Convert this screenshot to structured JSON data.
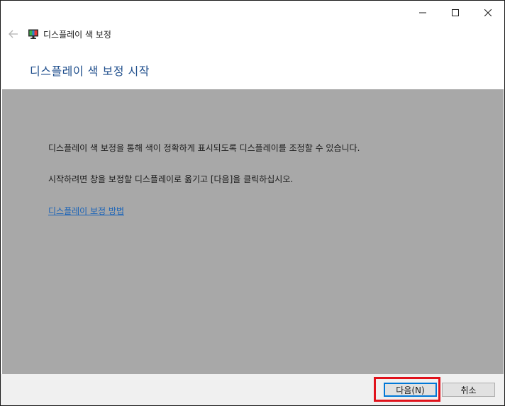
{
  "window": {
    "title": "디스플레이 색 보정",
    "caption_buttons": {
      "minimize_icon": "minimize-icon",
      "maximize_icon": "maximize-icon",
      "close_icon": "close-icon"
    }
  },
  "nav": {
    "back_icon": "back-arrow-icon",
    "app_icon": "display-icon",
    "app_title": "디스플레이 색 보정"
  },
  "page": {
    "heading": "디스플레이 색 보정 시작",
    "line1": "디스플레이 색 보정을 통해 색이 정확하게 표시되도록 디스플레이를 조정할 수 있습니다.",
    "line2": "시작하려면 창을 보정할 디스플레이로 옮기고 [다음]을 클릭하십시오.",
    "help_link": "디스플레이 보정 방법"
  },
  "footer": {
    "next_label": "다음(N)",
    "cancel_label": "취소"
  },
  "colors": {
    "heading": "#1f4e8c",
    "content_bg": "#a8a8a8",
    "link": "#1a63b8",
    "highlight": "#e0121b",
    "footer_bg": "#f0f0f0"
  }
}
